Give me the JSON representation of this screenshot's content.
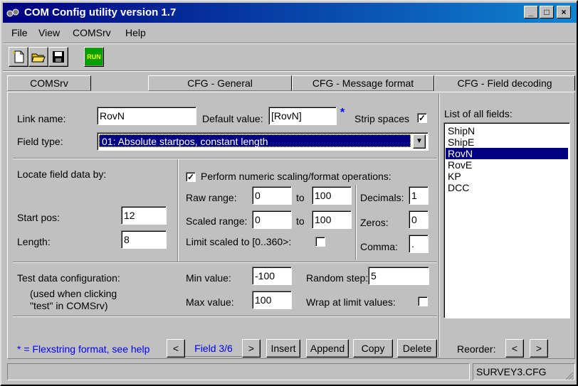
{
  "window": {
    "title": "COM Config utility version 1.7"
  },
  "menu": [
    "File",
    "View",
    "COMSrv",
    "Help"
  ],
  "toolbar": {
    "run_label": "RUN"
  },
  "tabs": [
    "COMSrv",
    "CFG - General",
    "CFG - Message format",
    "CFG - Field decoding"
  ],
  "field": {
    "link_name_label": "Link name:",
    "link_name_value": "RovN",
    "default_value_label": "Default value:",
    "default_value_value": "[RovN]",
    "asterisk": "*",
    "strip_spaces_label": "Strip spaces",
    "field_type_label": "Field type:",
    "field_type_value": "01: Absolute startpos, constant length"
  },
  "locate": {
    "label": "Locate field data by:",
    "start_pos_label": "Start pos:",
    "start_pos_value": "12",
    "length_label": "Length:",
    "length_value": "8"
  },
  "scaling": {
    "perform_label": "Perform numeric scaling/format operations:",
    "raw_range_label": "Raw range:",
    "raw_from": "0",
    "raw_to": "100",
    "scaled_range_label": "Scaled range:",
    "scaled_from": "0",
    "scaled_to": "100",
    "to_label": "to",
    "limit_label": "Limit scaled to [0..360>:",
    "decimals_label": "Decimals:",
    "decimals_value": "1",
    "zeros_label": "Zeros:",
    "zeros_value": "0",
    "comma_label": "Comma:",
    "comma_value": "."
  },
  "test": {
    "label": "Test data configuration:",
    "note_line1": "(used when clicking",
    "note_line2": "\"test\" in COMSrv)",
    "min_label": "Min value:",
    "min_value": "-100",
    "max_label": "Max value:",
    "max_value": "100",
    "random_step_label": "Random step:",
    "random_step_value": "5",
    "wrap_label": "Wrap at limit values:"
  },
  "fields_list": {
    "label": "List of all fields:",
    "items": [
      "ShipN",
      "ShipE",
      "RovN",
      "RovE",
      "KP",
      "DCC"
    ],
    "selected": "RovN"
  },
  "bottom": {
    "note": "* = Flexstring format, see help",
    "prev": "<",
    "next": ">",
    "field_counter": "Field 3/6",
    "insert": "Insert",
    "append": "Append",
    "copy": "Copy",
    "delete": "Delete",
    "reorder_label": "Reorder:",
    "reorder_left": "<",
    "reorder_right": ">"
  },
  "status": {
    "file": "SURVEY3.CFG"
  }
}
